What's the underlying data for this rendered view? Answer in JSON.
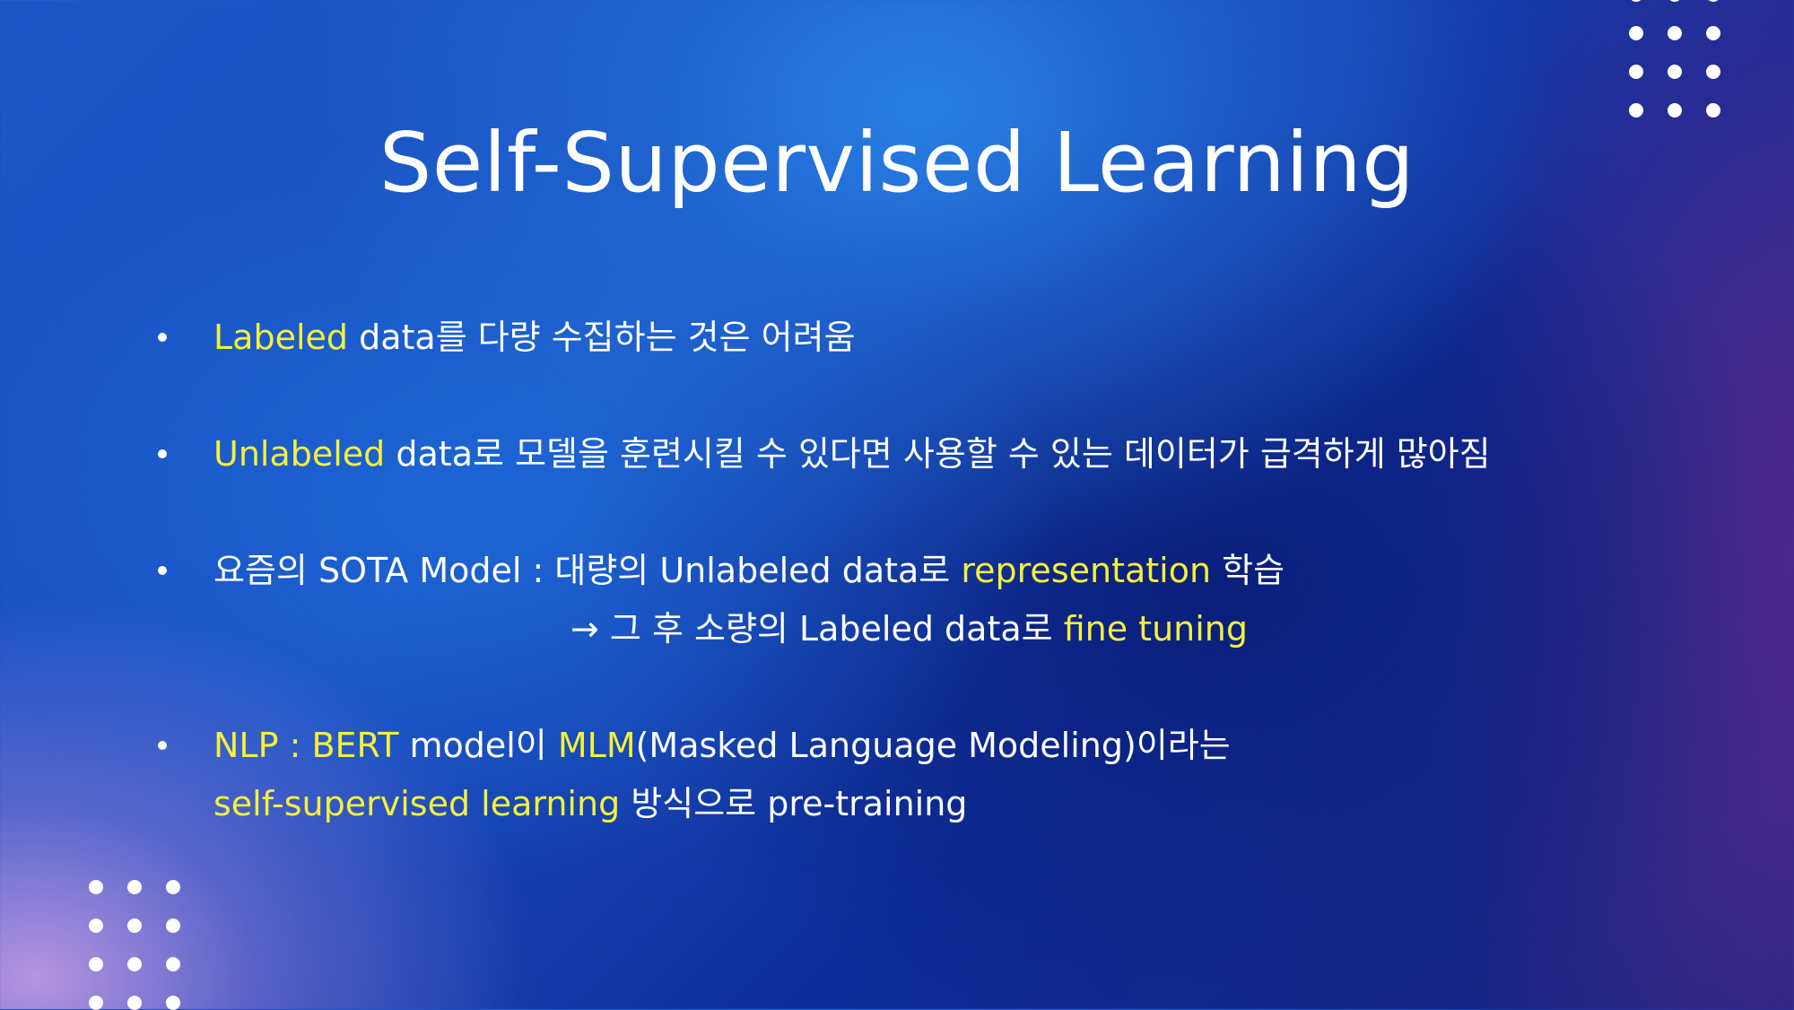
{
  "slide": {
    "title": "Self-Supervised Learning",
    "colors": {
      "highlight": "#f5f03b",
      "text": "#ffffff"
    },
    "bullets": [
      {
        "segments": [
          {
            "text": "Labeled",
            "highlight": true
          },
          {
            "text": " data를 다량 수집하는 것은 어려움",
            "highlight": false
          }
        ]
      },
      {
        "segments": [
          {
            "text": "Unlabeled",
            "highlight": true
          },
          {
            "text": " data로 모델을 훈련시킬 수 있다면 사용할 수 있는 데이터가 급격하게 많아짐",
            "highlight": false
          }
        ]
      },
      {
        "segments": [
          {
            "text": "요즘의 SOTA Model : 대량의 Unlabeled data로 ",
            "highlight": false
          },
          {
            "text": "representation",
            "highlight": true
          },
          {
            "text": " 학습",
            "highlight": false
          }
        ],
        "continuation": [
          {
            "text": "→ 그 후 소량의 Labeled data로 ",
            "highlight": false
          },
          {
            "text": "fine tuning",
            "highlight": true
          }
        ]
      },
      {
        "segments": [
          {
            "text": "NLP : BERT",
            "highlight": true
          },
          {
            "text": " model이 ",
            "highlight": false
          },
          {
            "text": "MLM",
            "highlight": true
          },
          {
            "text": "(Masked Language Modeling)이라는",
            "highlight": false
          }
        ],
        "continuation": [
          {
            "text": "self-supervised learning",
            "highlight": true
          },
          {
            "text": " 방식으로 pre-training",
            "highlight": false
          }
        ]
      }
    ]
  }
}
